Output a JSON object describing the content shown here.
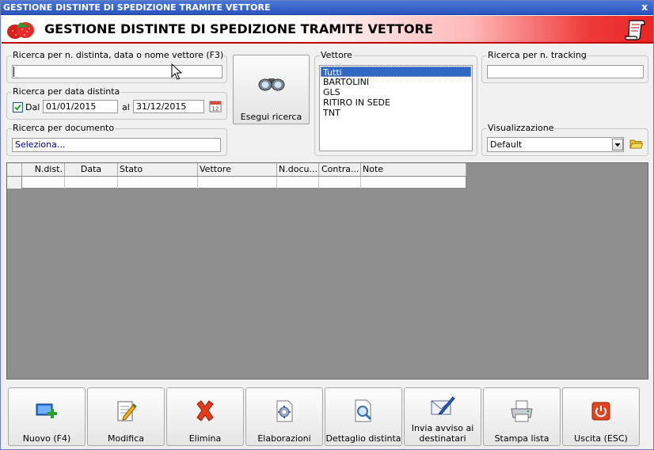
{
  "window": {
    "title": "GESTIONE DISTINTE DI SPEDIZIONE TRAMITE VETTORE",
    "close_glyph": "x"
  },
  "header": {
    "title": "GESTIONE DISTINTE DI SPEDIZIONE TRAMITE VETTORE",
    "logo_icon": "strawberry-logo-icon",
    "scroll_icon": "scroll-icon"
  },
  "search_text": {
    "label": "Ricerca per n. distinta, data o nome vettore (F3)",
    "value": ""
  },
  "search_date": {
    "label": "Ricerca per data distinta",
    "checkbox_label": "Dal",
    "checked": true,
    "from": "01/01/2015",
    "to_label": "al",
    "to": "31/12/2015"
  },
  "search_document": {
    "label": "Ricerca per documento",
    "value": "Seleziona..."
  },
  "run_search": {
    "label": "Esegui ricerca",
    "icon": "binoculars-icon"
  },
  "carrier": {
    "label": "Vettore",
    "items": [
      "Tutti",
      "BARTOLINI",
      "GLS",
      "RITIRO IN SEDE",
      "TNT"
    ],
    "selected": "Tutti"
  },
  "tracking": {
    "label": "Ricerca per n. tracking",
    "value": ""
  },
  "view": {
    "label": "Visualizzazione",
    "value": "Default"
  },
  "grid": {
    "columns": [
      "N.dist.",
      "Data",
      "Stato",
      "Vettore",
      "N.docu...",
      "Contra...",
      "Note"
    ]
  },
  "toolbar": {
    "buttons": [
      {
        "label": "Nuovo (F4)",
        "icon": "new-icon"
      },
      {
        "label": "Modifica",
        "icon": "edit-icon"
      },
      {
        "label": "Elimina",
        "icon": "delete-icon"
      },
      {
        "label": "Elaborazioni",
        "icon": "process-icon"
      },
      {
        "label": "Dettaglio distinta",
        "icon": "detail-icon"
      },
      {
        "label": "Invia avviso ai destinatari",
        "icon": "send-notice-icon"
      },
      {
        "label": "Stampa lista",
        "icon": "print-icon"
      },
      {
        "label": "Uscita (ESC)",
        "icon": "exit-icon"
      }
    ]
  },
  "colors": {
    "accent_red": "#e82525",
    "selection_blue": "#3168c6",
    "grid_bg": "#8f8f8f"
  }
}
